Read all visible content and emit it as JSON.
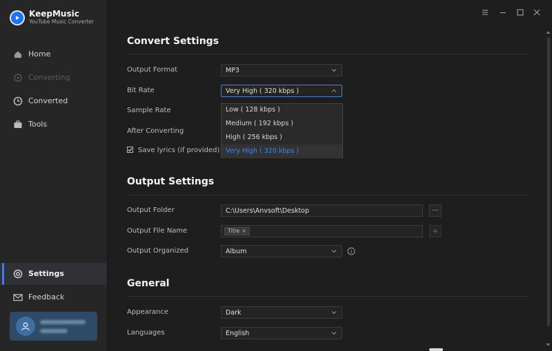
{
  "app": {
    "name": "KeepMusic",
    "subtitle": "YouTube Music Converter"
  },
  "sidebar": {
    "items": [
      {
        "label": "Home",
        "icon": "home-icon"
      },
      {
        "label": "Converting",
        "icon": "converting-icon",
        "state": "disabled"
      },
      {
        "label": "Converted",
        "icon": "clock-icon"
      },
      {
        "label": "Tools",
        "icon": "toolbox-icon"
      }
    ],
    "bottom_items": [
      {
        "label": "Settings",
        "icon": "settings-icon",
        "state": "active"
      },
      {
        "label": "Feedback",
        "icon": "mail-icon"
      }
    ]
  },
  "window_controls": [
    "menu-icon",
    "minimize-icon",
    "maximize-icon",
    "close-icon"
  ],
  "convert_settings": {
    "title": "Convert Settings",
    "output_format": {
      "label": "Output Format",
      "value": "MP3"
    },
    "bit_rate": {
      "label": "Bit Rate",
      "value": "Very High ( 320 kbps )",
      "options": [
        "Low ( 128 kbps )",
        "Medium ( 192 kbps )",
        "High ( 256 kbps )",
        "Very High ( 320 kbps )"
      ]
    },
    "sample_rate": {
      "label": "Sample Rate"
    },
    "after_converting": {
      "label": "After Converting"
    },
    "save_lyrics": {
      "label": "Save lyrics (if provided)",
      "checked": true
    }
  },
  "output_settings": {
    "title": "Output Settings",
    "output_folder": {
      "label": "Output Folder",
      "value": "C:\\Users\\Anvsoft\\Desktop",
      "browse": "···"
    },
    "output_file_name": {
      "label": "Output File Name",
      "tag": "Title",
      "add": "+"
    },
    "output_organized": {
      "label": "Output Organized",
      "value": "Album"
    }
  },
  "general": {
    "title": "General",
    "appearance": {
      "label": "Appearance",
      "value": "Dark"
    },
    "languages": {
      "label": "Languages",
      "value": "English"
    }
  },
  "colors": {
    "accent": "#3a86ff",
    "background": "#1e1e1e",
    "sidebar": "#262626"
  }
}
